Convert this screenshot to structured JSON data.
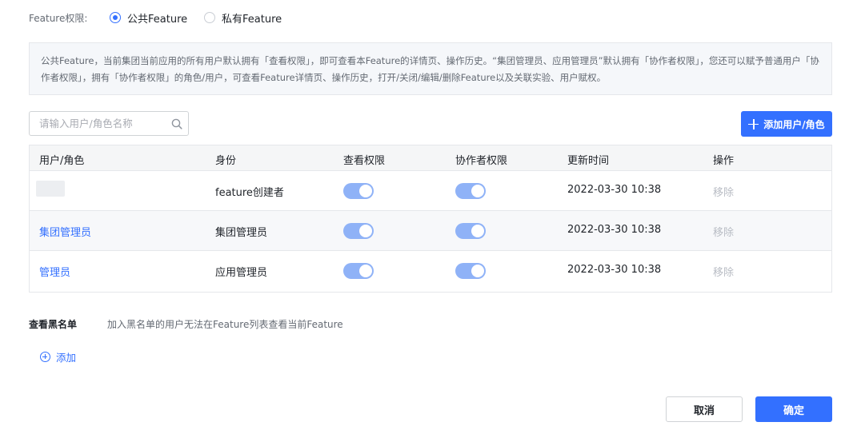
{
  "permission": {
    "label": "Feature权限:",
    "options": [
      {
        "label": "公共Feature",
        "selected": true
      },
      {
        "label": "私有Feature",
        "selected": false
      }
    ]
  },
  "info": {
    "text": "公共Feature，当前集团当前应用的所有用户默认拥有「查看权限」，即可查看本Feature的详情页、操作历史。“集团管理员、应用管理员”默认拥有「协作者权限」，您还可以赋予普通用户「协作者权限」，拥有「协作者权限」的角色/用户，可查看Feature详情页、操作历史，打开/关闭/编辑/删除Feature以及关联实验、用户赋权。"
  },
  "search": {
    "placeholder": "请输入用户/角色名称",
    "value": "",
    "icon": "search-icon"
  },
  "add_button": {
    "label": "添加用户/角色",
    "icon": "plus-icon"
  },
  "table": {
    "headers": [
      "用户/角色",
      "身份",
      "查看权限",
      "协作者权限",
      "更新时间",
      "操作"
    ],
    "rows": [
      {
        "name": "",
        "identity": "feature创建者",
        "view": true,
        "collab": true,
        "updated": "2022-03-30 10:38",
        "action": "移除"
      },
      {
        "name": "集团管理员",
        "identity": "集团管理员",
        "view": true,
        "collab": true,
        "updated": "2022-03-30 10:38",
        "action": "移除"
      },
      {
        "name": "管理员",
        "identity": "应用管理员",
        "view": true,
        "collab": true,
        "updated": "2022-03-30 10:38",
        "action": "移除"
      }
    ]
  },
  "blacklist": {
    "label": "查看黑名单",
    "description": "加入黑名单的用户无法在Feature列表查看当前Feature",
    "add_label": "添加"
  },
  "footer": {
    "cancel": "取消",
    "confirm": "确定"
  },
  "colors": {
    "primary": "#3370ff",
    "switch_disabled_on": "#8fb2f7"
  }
}
